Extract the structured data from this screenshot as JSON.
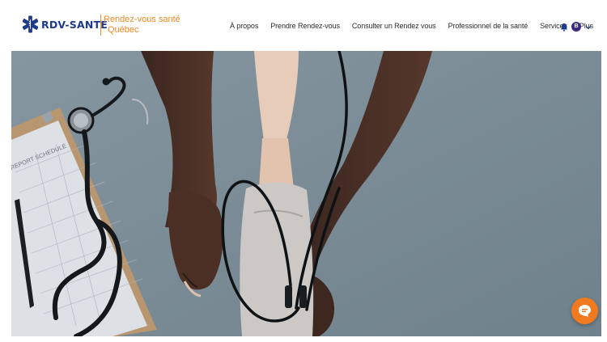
{
  "brand": {
    "name": "RDV-SANTE",
    "tagline_line1": "Rendez-vous santé",
    "tagline_line2": "Québec",
    "accent_color": "#f08a24",
    "primary_color": "#1f3a8a"
  },
  "nav": {
    "items": [
      {
        "label": "À propos"
      },
      {
        "label": "Prendre Rendez-vous"
      },
      {
        "label": "Consulter un Rendez vous"
      },
      {
        "label": "Professionnel de la santé"
      },
      {
        "label": "Services"
      },
      {
        "label": "Plus"
      }
    ]
  },
  "user": {
    "avatar_initial": "B",
    "notification_icon": "bell-icon",
    "menu_icon": "chevron-down-icon"
  },
  "hero": {
    "image_description_icon": "blood-pressure-photo",
    "clipboard_text": "REPORT SCHEDULE"
  },
  "chat": {
    "icon": "chat-icon",
    "color": "#f07a1f"
  }
}
